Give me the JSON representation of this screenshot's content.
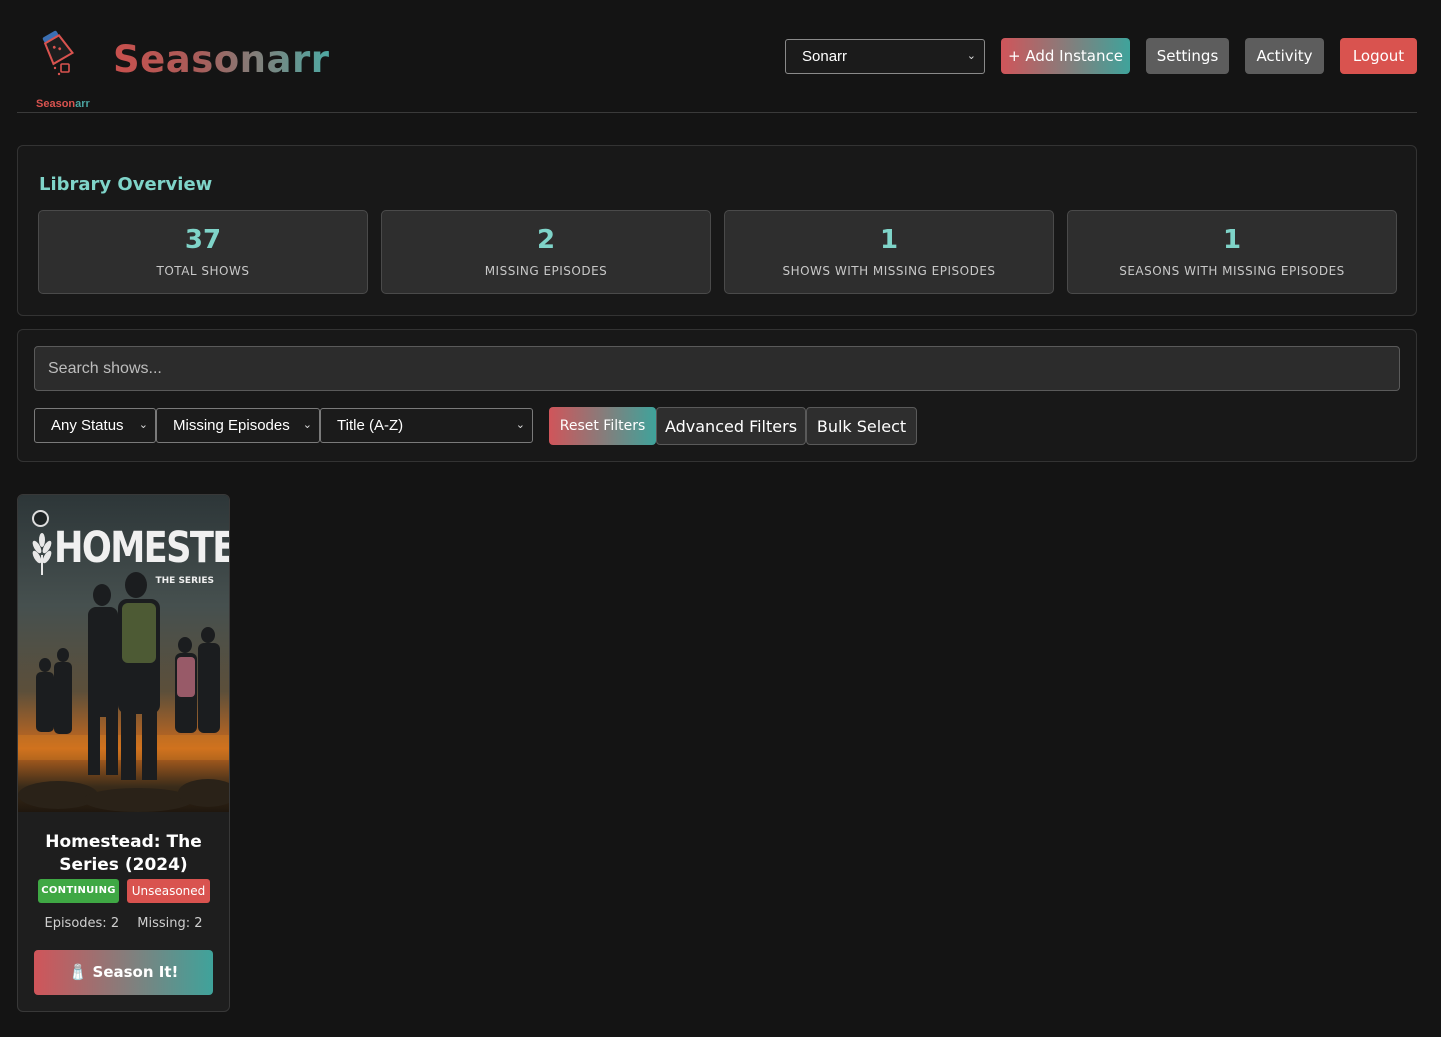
{
  "header": {
    "logo_text_a": "Season",
    "logo_text_b": "arr",
    "brand": "Seasonarr",
    "instance_select": "Sonarr",
    "buttons": {
      "add_instance": "+ Add Instance",
      "settings": "Settings",
      "activity": "Activity",
      "logout": "Logout"
    }
  },
  "overview": {
    "title": "Library Overview",
    "stats": [
      {
        "value": "37",
        "label": "TOTAL SHOWS"
      },
      {
        "value": "2",
        "label": "MISSING EPISODES"
      },
      {
        "value": "1",
        "label": "SHOWS WITH MISSING EPISODES"
      },
      {
        "value": "1",
        "label": "SEASONS WITH MISSING EPISODES"
      }
    ]
  },
  "filters": {
    "search_placeholder": "Search shows...",
    "status_select": "Any Status",
    "missing_select": "Missing Episodes",
    "sort_select": "Title (A-Z)",
    "reset": "Reset Filters",
    "advanced": "Advanced Filters",
    "bulk": "Bulk Select"
  },
  "shows": [
    {
      "poster_title": "HOMESTEAD",
      "poster_subtitle": "THE SERIES",
      "title": "Homestead: The Series (2024)",
      "status_badge": "CONTINUING",
      "tag_badge": "Unseasoned",
      "episodes": "Episodes: 2",
      "missing": "Missing: 2",
      "action": "🧂 Season It!"
    }
  ],
  "colors": {
    "accent_teal": "#7fd4c9",
    "accent_red": "#d9534f",
    "status_green": "#3fa844",
    "gradient_start": "#d0555a",
    "gradient_end": "#3fa39b"
  }
}
